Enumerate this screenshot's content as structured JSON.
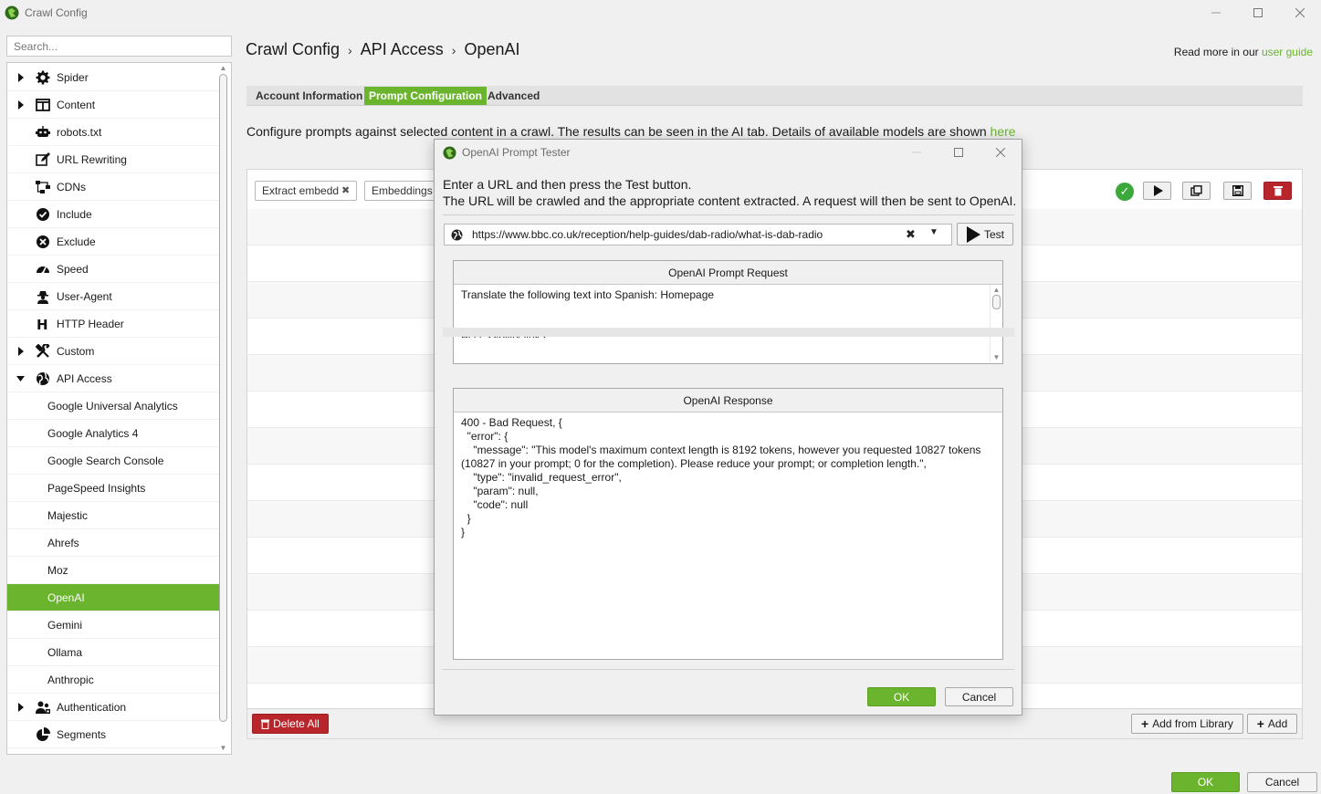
{
  "window": {
    "title": "Crawl Config"
  },
  "search": {
    "placeholder": "Search..."
  },
  "sidebar": {
    "items": [
      {
        "label": "Spider",
        "expandable": true,
        "icon": "gear-icon"
      },
      {
        "label": "Content",
        "expandable": true,
        "icon": "columns-icon"
      },
      {
        "label": "robots.txt",
        "expandable": false,
        "icon": "robot-icon"
      },
      {
        "label": "URL Rewriting",
        "expandable": false,
        "icon": "edit-icon"
      },
      {
        "label": "CDNs",
        "expandable": false,
        "icon": "network-icon"
      },
      {
        "label": "Include",
        "expandable": false,
        "icon": "check-circle-icon"
      },
      {
        "label": "Exclude",
        "expandable": false,
        "icon": "x-circle-icon"
      },
      {
        "label": "Speed",
        "expandable": false,
        "icon": "speedometer-icon"
      },
      {
        "label": "User-Agent",
        "expandable": false,
        "icon": "user-secret-icon"
      },
      {
        "label": "HTTP Header",
        "expandable": false,
        "icon": "header-icon"
      },
      {
        "label": "Custom",
        "expandable": true,
        "icon": "tools-icon"
      },
      {
        "label": "API Access",
        "expandable": true,
        "expanded": true,
        "icon": "globe-icon"
      },
      {
        "label": "Google Universal Analytics",
        "child": true
      },
      {
        "label": "Google Analytics 4",
        "child": true
      },
      {
        "label": "Google Search Console",
        "child": true
      },
      {
        "label": "PageSpeed Insights",
        "child": true
      },
      {
        "label": "Majestic",
        "child": true
      },
      {
        "label": "Ahrefs",
        "child": true
      },
      {
        "label": "Moz",
        "child": true
      },
      {
        "label": "OpenAI",
        "child": true,
        "selected": true
      },
      {
        "label": "Gemini",
        "child": true
      },
      {
        "label": "Ollama",
        "child": true
      },
      {
        "label": "Anthropic",
        "child": true
      },
      {
        "label": "Authentication",
        "expandable": true,
        "icon": "users-icon"
      },
      {
        "label": "Segments",
        "expandable": false,
        "icon": "pie-chart-icon"
      }
    ]
  },
  "breadcrumb": [
    "Crawl Config",
    "API Access",
    "OpenAI"
  ],
  "breadcrumb_sep": "›",
  "readmore": {
    "prefix": "Read more in our ",
    "link": "user guide"
  },
  "tabs": [
    {
      "label": "Account Information",
      "active": false
    },
    {
      "label": "Prompt Configuration",
      "active": true
    },
    {
      "label": "Advanced",
      "active": false
    }
  ],
  "description": {
    "text": "Configure prompts against selected content in a crawl. The results can be seen in the AI tab. Details of available models are shown ",
    "link": "here"
  },
  "chips": [
    {
      "label": "Extract embedd"
    },
    {
      "label": "Embeddings"
    }
  ],
  "panel_footer": {
    "delete_all": "Delete All",
    "add_from_library": "Add from Library",
    "add": "Add"
  },
  "dialog": {
    "title": "OpenAI Prompt Tester",
    "intro_line1": "Enter a URL and then press the Test button.",
    "intro_line2": "The URL will be crawled and the appropriate content extracted. A request will then be sent to OpenAI.",
    "url": "https://www.bbc.co.uk/reception/help-guides/dab-radio/what-is-dab-radio",
    "test_label": "Test",
    "request_header": "OpenAI Prompt Request",
    "request_text": "Translate the following text into Spanish: Homepage\n\n\nAccessibility links\n\n  • Skip to content",
    "response_header": "OpenAI Response",
    "response_text": "400 - Bad Request, {\n  \"error\": {\n    \"message\": \"This model's maximum context length is 8192 tokens, however you requested 10827 tokens\n(10827 in your prompt; 0 for the completion). Please reduce your prompt; or completion length.\",\n    \"type\": \"invalid_request_error\",\n    \"param\": null,\n    \"code\": null\n  }\n}",
    "ok_label": "OK",
    "cancel_label": "Cancel"
  },
  "footer": {
    "ok_label": "OK",
    "cancel_label": "Cancel"
  },
  "colors": {
    "accent": "#6ab42e",
    "danger": "#b8262b",
    "success": "#3aa83a"
  }
}
